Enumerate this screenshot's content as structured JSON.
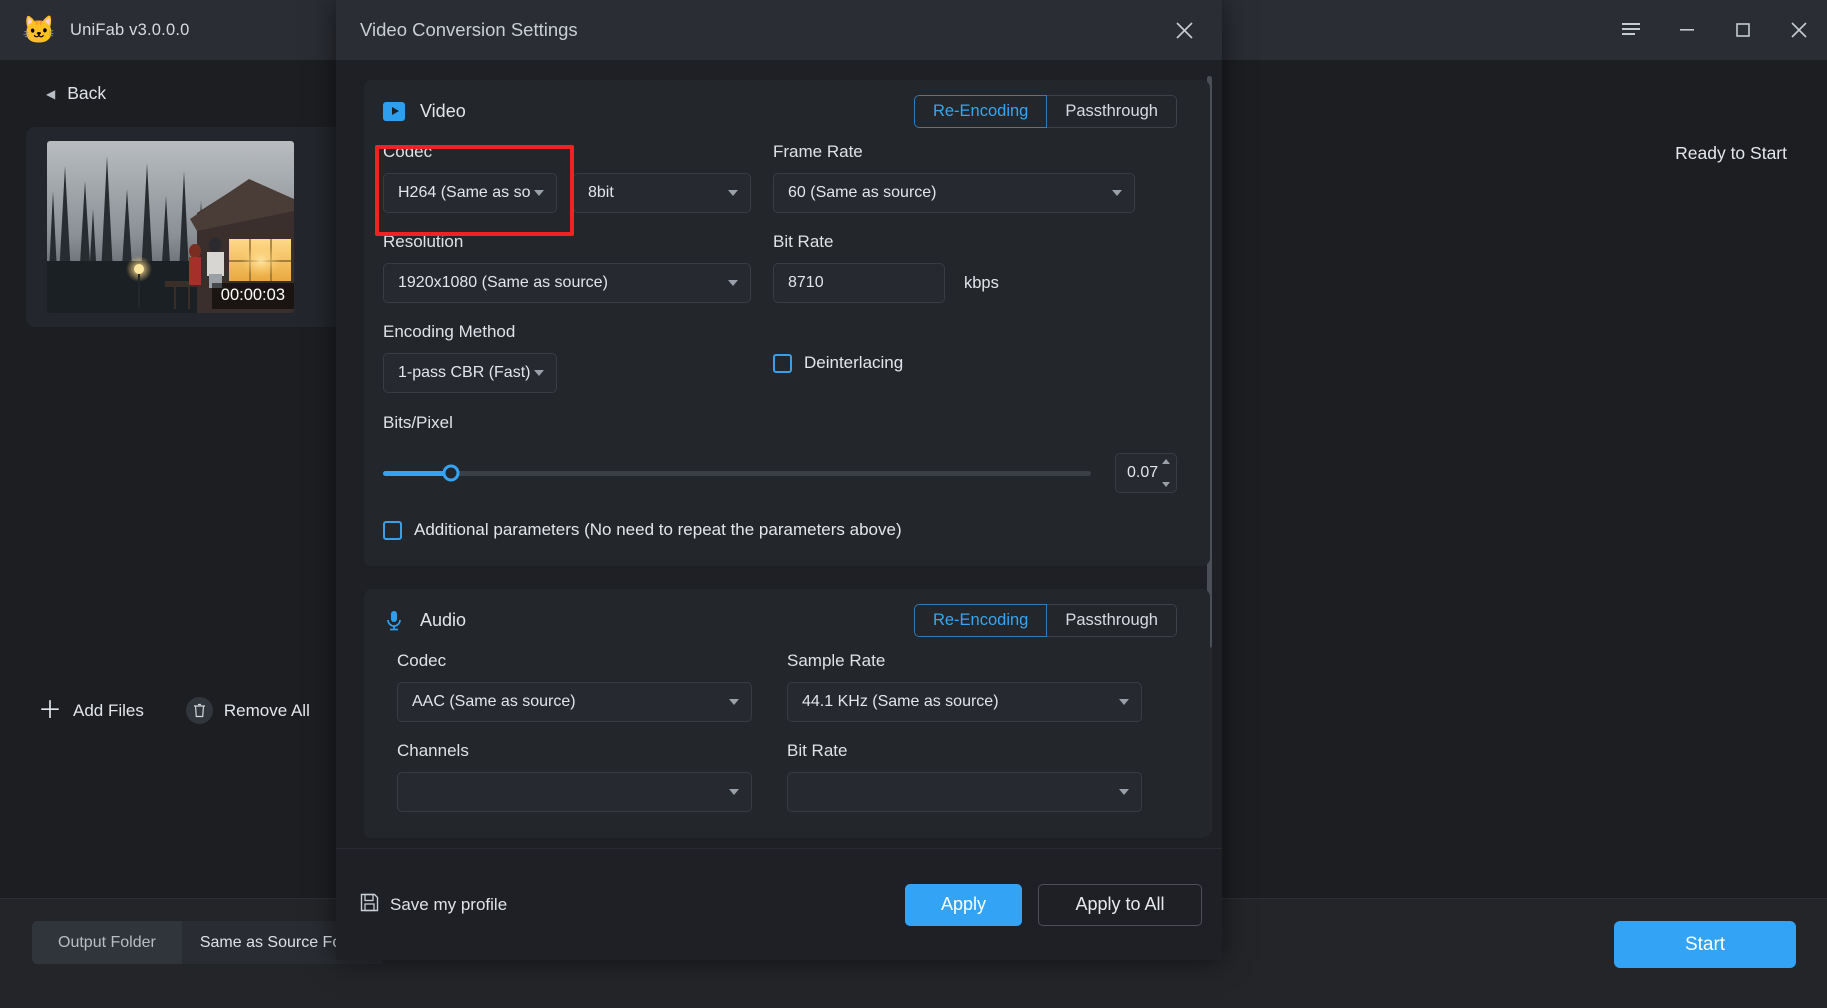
{
  "window": {
    "app_title": "UniFab v3.0.0.0",
    "logo_icon": "cat-icon",
    "menu_icon": "hamburger-menu-icon",
    "minimize_icon": "minimize-icon",
    "maximize_icon": "maximize-icon",
    "close_icon": "close-icon"
  },
  "left_panel": {
    "back_label": "Back",
    "back_icon": "chevron-left-icon",
    "file": {
      "duration": "00:00:03",
      "thumbnail": "video-thumbnail-night-cabin-forest"
    },
    "add_files_label": "Add Files",
    "add_files_icon": "plus-icon",
    "remove_all_label": "Remove All",
    "remove_all_icon": "trash-icon"
  },
  "status": {
    "ready_text": "Ready to Start"
  },
  "bottom_bar": {
    "output_folder_label": "Output Folder",
    "output_folder_value": "Same as Source Folder",
    "start_label": "Start"
  },
  "dialog": {
    "title": "Video Conversion Settings",
    "close_icon": "close-icon",
    "video": {
      "section_title": "Video",
      "section_icon": "video-play-icon",
      "mode_options": [
        "Re-Encoding",
        "Passthrough"
      ],
      "mode_selected": "Re-Encoding",
      "codec_label": "Codec",
      "codec_value": "H264 (Same as so",
      "bit_depth_value": "8bit",
      "frame_rate_label": "Frame Rate",
      "frame_rate_value": "60 (Same as source)",
      "resolution_label": "Resolution",
      "resolution_value": "1920x1080 (Same as source)",
      "bit_rate_label": "Bit Rate",
      "bit_rate_value": "8710",
      "bit_rate_unit": "kbps",
      "encoding_method_label": "Encoding Method",
      "encoding_method_value": "1-pass CBR (Fast)",
      "deinterlacing_label": "Deinterlacing",
      "deinterlacing_checked": false,
      "bits_per_pixel_label": "Bits/Pixel",
      "bits_per_pixel_value": "0.07",
      "additional_parameters_label": "Additional parameters (No need to repeat the parameters above)",
      "additional_parameters_checked": false,
      "highlight_color": "#f22222"
    },
    "audio": {
      "section_title": "Audio",
      "section_icon": "microphone-icon",
      "mode_options": [
        "Re-Encoding",
        "Passthrough"
      ],
      "mode_selected": "Re-Encoding",
      "codec_label": "Codec",
      "codec_value": "AAC (Same as source)",
      "sample_rate_label": "Sample Rate",
      "sample_rate_value": "44.1 KHz (Same as source)",
      "channels_label": "Channels",
      "bit_rate_label": "Bit Rate"
    },
    "footer": {
      "save_profile_label": "Save my profile",
      "save_profile_icon": "floppy-save-icon",
      "apply_label": "Apply",
      "apply_all_label": "Apply to All"
    }
  },
  "colors": {
    "accent": "#33a3f5",
    "highlight": "#f22222",
    "panel": "#23262b",
    "background": "#1c1e22"
  }
}
